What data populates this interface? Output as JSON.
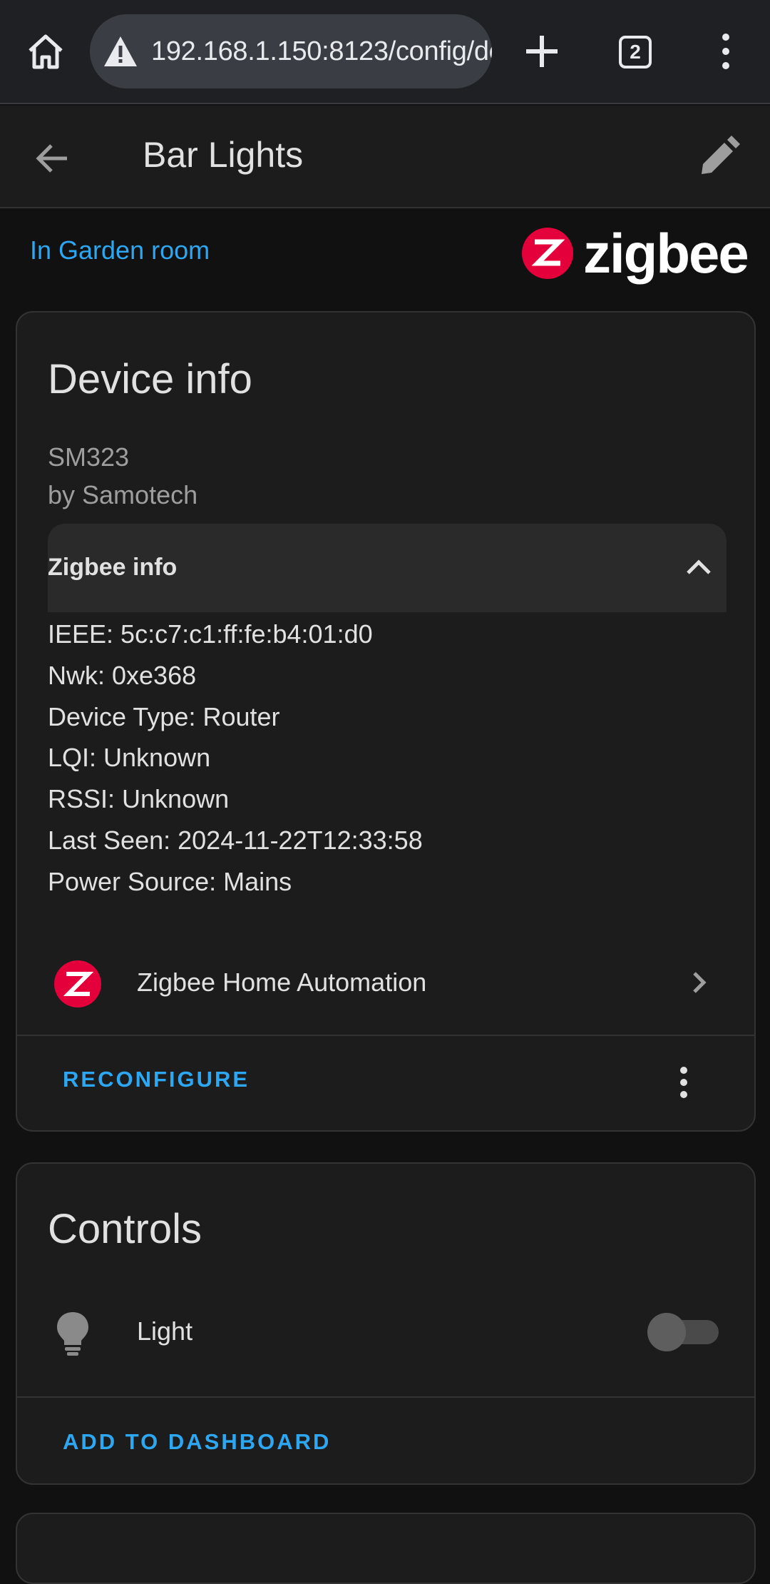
{
  "browser": {
    "url": "192.168.1.150:8123/config/de",
    "tab_count": "2"
  },
  "toolbar": {
    "title": "Bar Lights"
  },
  "area": {
    "link_text": "In Garden room"
  },
  "brand": {
    "logo_text": "zigbee",
    "accent_color": "#e4003b"
  },
  "device_info": {
    "title": "Device info",
    "model": "SM323",
    "manufacturer": "by Samotech",
    "expander_label": "Zigbee info",
    "lines": [
      "IEEE: 5c:c7:c1:ff:fe:b4:01:d0",
      "Nwk: 0xe368",
      "Device Type: Router",
      "LQI: Unknown",
      "RSSI: Unknown",
      "Last Seen: 2024-11-22T12:33:58",
      "Power Source: Mains"
    ],
    "integration_label": "Zigbee Home Automation",
    "reconfigure_label": "RECONFIGURE"
  },
  "controls": {
    "title": "Controls",
    "items": [
      {
        "label": "Light",
        "icon": "lightbulb-icon",
        "state": "off"
      }
    ],
    "add_to_dashboard_label": "ADD TO DASHBOARD"
  },
  "colors": {
    "link": "#2ea7f2",
    "background": "#111111",
    "card": "#1c1c1c"
  }
}
